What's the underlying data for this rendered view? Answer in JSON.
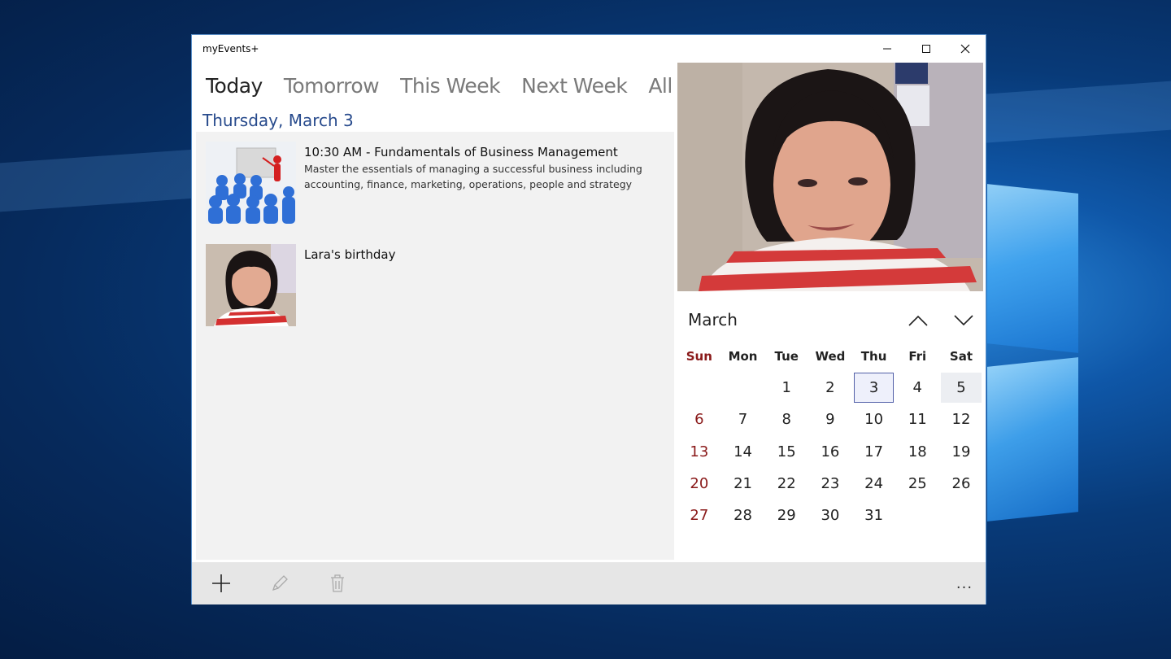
{
  "window": {
    "title": "myEvents+",
    "controls": {
      "minimize": "minimize-icon",
      "maximize": "maximize-icon",
      "close": "close-icon"
    }
  },
  "tabs": [
    {
      "label": "Today",
      "active": true
    },
    {
      "label": "Tomorrow",
      "active": false
    },
    {
      "label": "This Week",
      "active": false
    },
    {
      "label": "Next Week",
      "active": false
    },
    {
      "label": "All",
      "active": false
    }
  ],
  "date_heading": "Thursday, March 3",
  "events": [
    {
      "title": "10:30 AM - Fundamentals of Business Management",
      "description": "Master the essentials of managing a successful business including accounting, finance, marketing, operations, people and strategy",
      "thumbnail": "presentation-clipart"
    },
    {
      "title": "Lara's birthday",
      "description": "",
      "thumbnail": "portrait-photo"
    }
  ],
  "calendar": {
    "month": "March",
    "weekdays": [
      "Sun",
      "Mon",
      "Tue",
      "Wed",
      "Thu",
      "Fri",
      "Sat"
    ],
    "days": [
      "",
      "",
      "1",
      "2",
      "3",
      "4",
      "5",
      "6",
      "7",
      "8",
      "9",
      "10",
      "11",
      "12",
      "13",
      "14",
      "15",
      "16",
      "17",
      "18",
      "19",
      "20",
      "21",
      "22",
      "23",
      "24",
      "25",
      "26",
      "27",
      "28",
      "29",
      "30",
      "31",
      "",
      ""
    ],
    "today": "3",
    "highlighted": "5",
    "colors": {
      "sunday": "#8a1a1a",
      "today_border": "#5260a8",
      "heading": "#274a8c"
    }
  },
  "appbar": {
    "buttons": [
      {
        "icon": "add-icon",
        "enabled": true
      },
      {
        "icon": "edit-icon",
        "enabled": false
      },
      {
        "icon": "delete-icon",
        "enabled": false
      }
    ],
    "more": "..."
  }
}
